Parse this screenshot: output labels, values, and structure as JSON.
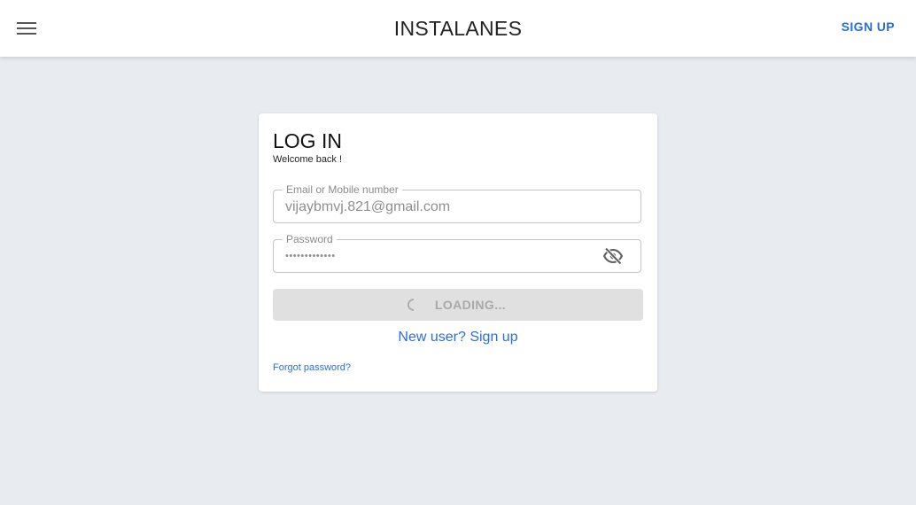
{
  "header": {
    "brand": "INSTALANES",
    "signup_label": "SIGN UP",
    "menu_icon": "hamburger-menu-icon"
  },
  "login": {
    "title": "LOG IN",
    "subtitle": "Welcome back !",
    "email": {
      "label": "Email or Mobile number",
      "value": "vijaybmvj.821@gmail.com"
    },
    "password": {
      "label": "Password",
      "value": "•••••••••••••",
      "toggle_icon": "eye-off-icon"
    },
    "submit_label": "LOADING...",
    "spinner_icon": "spinner-icon",
    "new_user_link": "New user? Sign up",
    "forgot_link": "Forgot password?"
  },
  "colors": {
    "accent": "#2a6fd6",
    "background": "#e8ebf0",
    "card": "#ffffff",
    "disabled_button": "#e0e0e0"
  }
}
